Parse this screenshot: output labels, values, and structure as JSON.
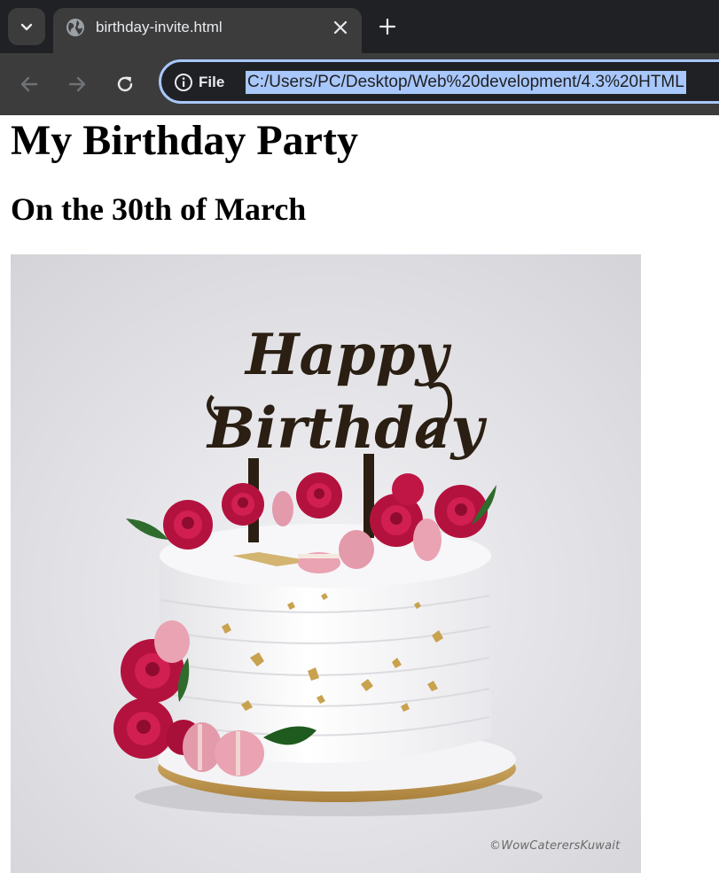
{
  "browser": {
    "tab": {
      "title": "birthday-invite.html"
    },
    "omnibox": {
      "site_info_label": "File",
      "url": "C:/Users/PC/Desktop/Web%20development/4.3%20HTML"
    }
  },
  "page": {
    "heading": "My Birthday Party",
    "subheading": "On the 30th of March",
    "image": {
      "topper_text": [
        "Happy",
        "Birthday"
      ],
      "watermark": "©WowCaterersKuwait"
    }
  },
  "colors": {
    "chrome_dark": "#202124",
    "chrome_tab": "#3c3c3c",
    "url_highlight": "#a8c7fa",
    "rose": "#b4123e",
    "macaron": "#e9a3b2"
  },
  "icons": [
    "tab-search-icon",
    "globe-icon",
    "close-icon",
    "plus-icon",
    "back-arrow-icon",
    "forward-arrow-icon",
    "reload-icon",
    "info-icon"
  ]
}
